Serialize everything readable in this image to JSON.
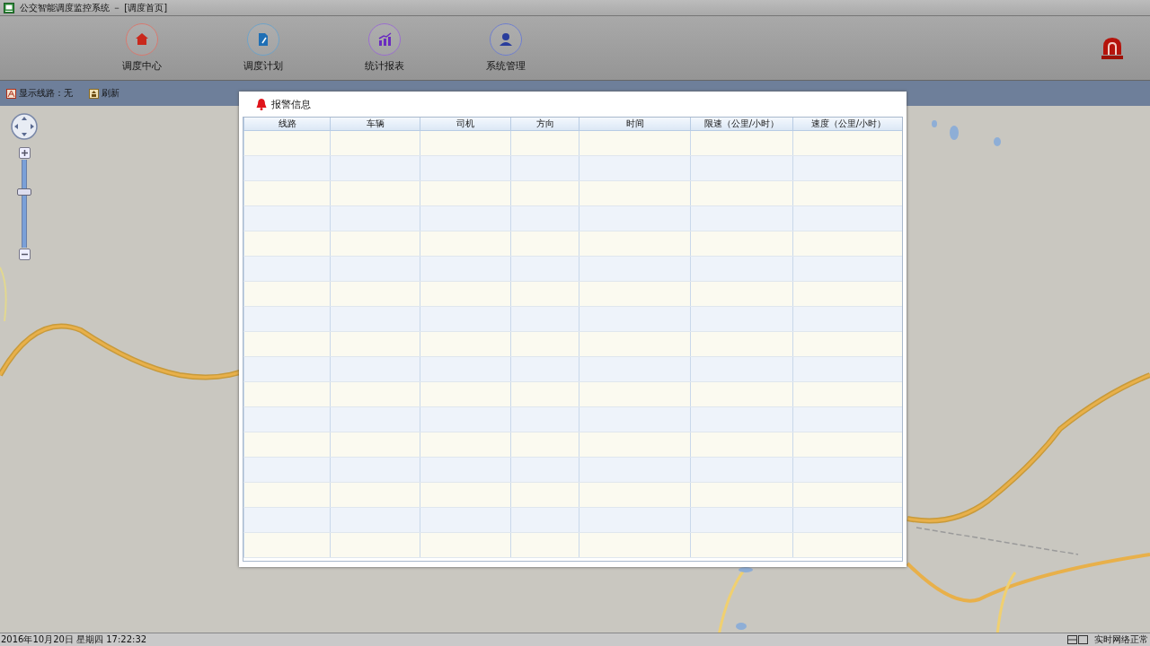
{
  "window": {
    "title": "公交智能调度监控系统 － [调度首页]"
  },
  "nav": [
    {
      "label": "调度中心",
      "kind": "home"
    },
    {
      "label": "调度计划",
      "kind": "plan"
    },
    {
      "label": "统计报表",
      "kind": "chart"
    },
    {
      "label": "系统管理",
      "kind": "user"
    }
  ],
  "toolbar": [
    {
      "label": "显示线路：无",
      "kind": "route"
    },
    {
      "label": "刷新",
      "kind": "refresh"
    }
  ],
  "map": {
    "zoom_slider": {
      "level": 0.65
    }
  },
  "alarm_dialog": {
    "title": "报警信息",
    "columns": [
      "线路",
      "车辆",
      "司机",
      "方向",
      "时间",
      "限速（公里/小时）",
      "速度（公里/小时）"
    ]
  },
  "status_bar": {
    "datetime": "2016年10月20日 星期四 17:22:32",
    "network": "实时网络正常"
  }
}
